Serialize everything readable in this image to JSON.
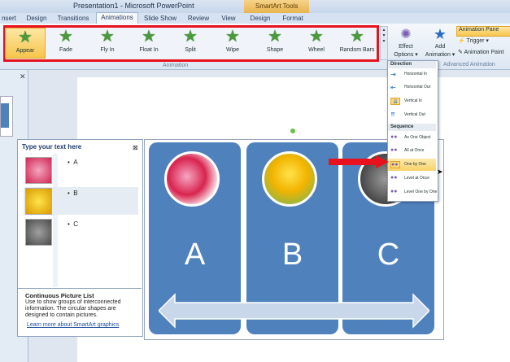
{
  "window": {
    "title": "Presentation1 - Microsoft PowerPoint",
    "contextual_group": "SmartArt Tools"
  },
  "tabs": [
    {
      "label": "nsert",
      "active": false
    },
    {
      "label": "Design",
      "active": false
    },
    {
      "label": "Transitions",
      "active": false
    },
    {
      "label": "Animations",
      "active": true
    },
    {
      "label": "Slide Show",
      "active": false
    },
    {
      "label": "Review",
      "active": false
    },
    {
      "label": "View",
      "active": false
    },
    {
      "label": "Design",
      "active": false
    },
    {
      "label": "Format",
      "active": false
    }
  ],
  "ribbon": {
    "animation_group_label": "Animation",
    "animations": [
      {
        "label": "Appear",
        "selected": true
      },
      {
        "label": "Fade",
        "selected": false
      },
      {
        "label": "Fly In",
        "selected": false
      },
      {
        "label": "Float In",
        "selected": false
      },
      {
        "label": "Split",
        "selected": false
      },
      {
        "label": "Wipe",
        "selected": false
      },
      {
        "label": "Shape",
        "selected": false
      },
      {
        "label": "Wheel",
        "selected": false
      },
      {
        "label": "Random Bars",
        "selected": false
      }
    ],
    "effect_options": {
      "line1": "Effect",
      "line2": "Options ▾"
    },
    "add_animation": {
      "line1": "Add",
      "line2": "Animation ▾"
    },
    "advanced": {
      "group_label": "Advanced Animation",
      "animation_pane": "Animation Pane",
      "trigger": "Trigger ▾",
      "animation_painter": "Animation Paint"
    }
  },
  "text_pane": {
    "title": "Type your text here",
    "items": [
      "A",
      "B",
      "C"
    ],
    "desc_title": "Continuous Picture List",
    "desc": "Use to show groups of interconnected information. The circular shapes are designed to contain pictures.",
    "link": "Learn more about SmartArt graphics"
  },
  "smartart": {
    "letters": [
      "A",
      "B",
      "C"
    ],
    "fill_color": "#4f81bd"
  },
  "dropdown": {
    "direction_header": "Direction",
    "direction_items": [
      "Horizontal In",
      "Horizontal Out",
      "Vertical In",
      "Vertical Out"
    ],
    "sequence_header": "Sequence",
    "sequence_items": [
      "As One Object",
      "All at Once",
      "One by One",
      "Level at Once",
      "Level One by One"
    ],
    "checked": [
      "Vertical In",
      "One by One"
    ]
  }
}
